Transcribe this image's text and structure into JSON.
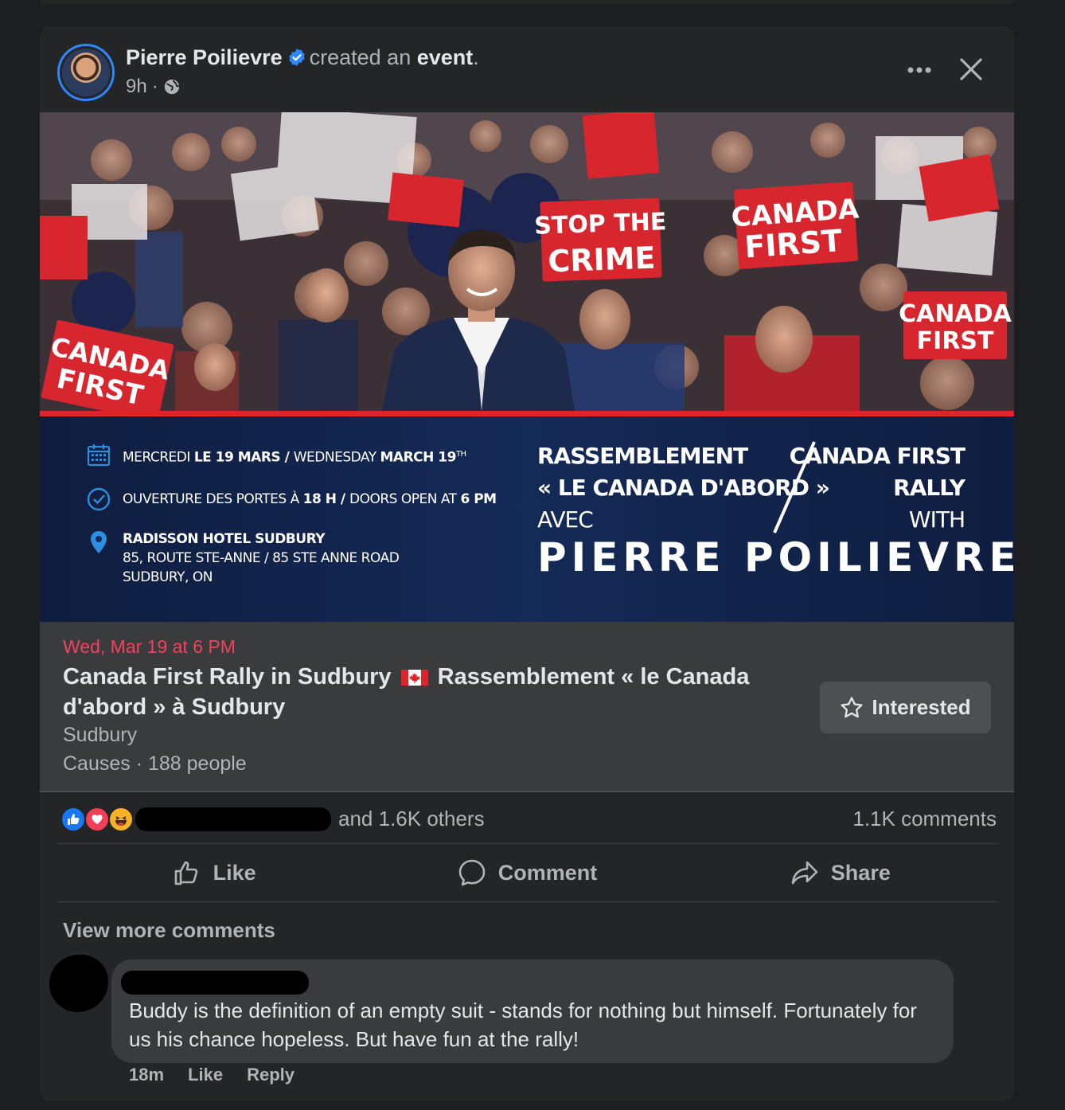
{
  "post": {
    "author": "Pierre Poilievre",
    "action_text": "created an",
    "action_object": "event",
    "action_end": ".",
    "time": "9h",
    "separator": "·",
    "more_icon": "more-horizontal-icon",
    "close_icon": "close-icon"
  },
  "banner": {
    "signs": [
      "STOP THE",
      "CRIME",
      "CANADA",
      "FIRST",
      "CANADA",
      "FIRST",
      "CANADA",
      "FIRST"
    ],
    "date_fr_a": "MERCREDI ",
    "date_fr_b": "LE 19 MARS",
    "date_sep": " / ",
    "date_en_a": "WEDNESDAY ",
    "date_en_b": "MARCH 19",
    "date_en_sup": "TH",
    "doors_fr_a": "OUVERTURE DES PORTES À ",
    "doors_fr_b": "18 H",
    "doors_sep": " / ",
    "doors_en_a": "DOORS OPEN AT ",
    "doors_en_b": "6 PM",
    "venue_name": "RADISSON HOTEL SUDBURY",
    "venue_line2": "85, ROUTE STE-ANNE / 85 STE ANNE ROAD",
    "venue_line3": "SUDBURY, ON",
    "rally_fr_1": "RASSEMBLEMENT",
    "rally_fr_2": "« LE CANADA D'ABORD »",
    "rally_fr_3": "AVEC",
    "rally_en_1": "CANADA FIRST",
    "rally_en_2": "RALLY",
    "rally_en_3": "WITH",
    "speaker": "PIERRE POILIEVRE",
    "accent_red": "#e0242b",
    "navy": "#142a57"
  },
  "event": {
    "date": "Wed, Mar 19 at 6 PM",
    "title_part1": "Canada First Rally in Sudbury",
    "title_part2": "Rassemblement « le Canada d'abord » à Sudbury",
    "location": "Sudbury",
    "meta": "Causes · 188 people",
    "interested_label": "Interested"
  },
  "reactions": {
    "icons": [
      "like-icon",
      "love-icon",
      "haha-icon"
    ],
    "others": "and 1.6K others",
    "comments": "1.1K comments"
  },
  "actions": {
    "like": "Like",
    "comment": "Comment",
    "share": "Share"
  },
  "comments": {
    "view_more": "View more comments",
    "items": [
      {
        "text": "Buddy is the definition of an empty suit - stands for nothing but himself. Fortunately for us his chance hopeless. But have fun at the rally!",
        "time": "18m",
        "like": "Like",
        "reply": "Reply"
      }
    ]
  },
  "colors": {
    "background": "#1c1e21",
    "card": "#242526",
    "event_date": "#f3425f",
    "verified": "#2d88ff"
  }
}
